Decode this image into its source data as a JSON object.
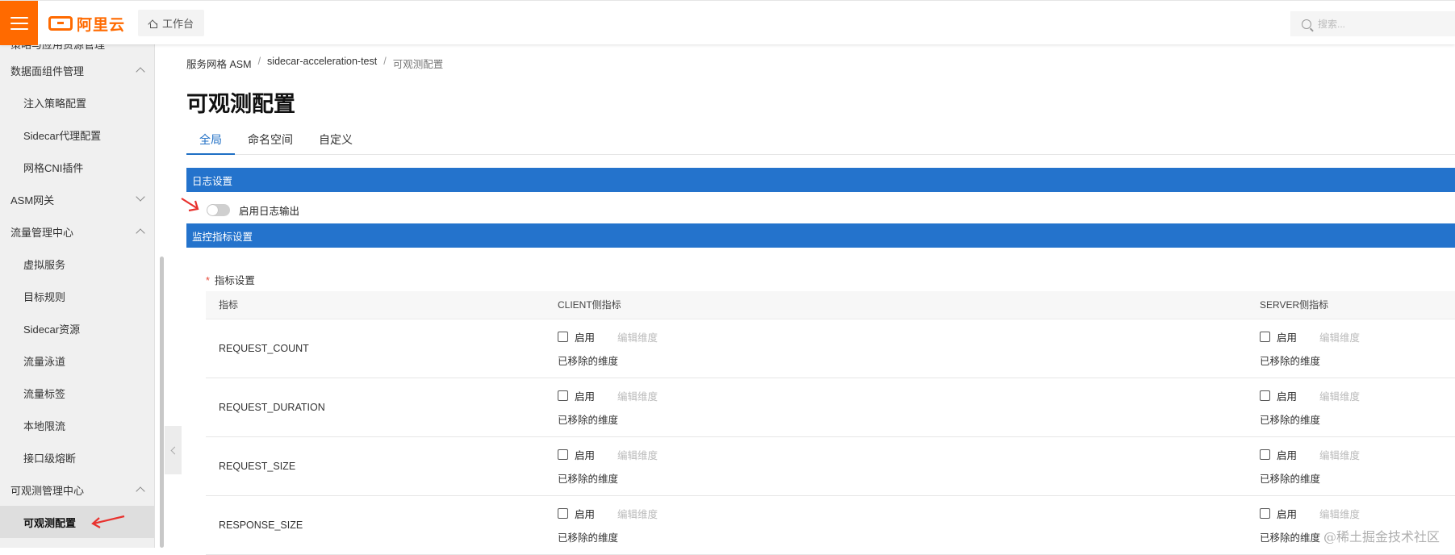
{
  "topbar": {
    "logo_text": "阿里云",
    "workbench_label": "工作台",
    "search_placeholder": "搜索..."
  },
  "sidebar": {
    "cut_item": "策略与应用资源管理",
    "groups": [
      {
        "label": "数据面组件管理",
        "expanded": true
      },
      {
        "label": "ASM网关",
        "expanded": false
      },
      {
        "label": "流量管理中心",
        "expanded": true
      },
      {
        "label": "可观测管理中心",
        "expanded": true
      }
    ],
    "items": [
      {
        "label": "注入策略配置"
      },
      {
        "label": "Sidecar代理配置"
      },
      {
        "label": "网格CNI插件"
      },
      {
        "label": "虚拟服务"
      },
      {
        "label": "目标规则"
      },
      {
        "label": "Sidecar资源"
      },
      {
        "label": "流量泳道"
      },
      {
        "label": "流量标签"
      },
      {
        "label": "本地限流"
      },
      {
        "label": "接口级熔断"
      },
      {
        "label": "可观测配置",
        "active": true
      }
    ]
  },
  "breadcrumb": [
    "服务网格 ASM",
    "sidecar-acceleration-test",
    "可观测配置"
  ],
  "page_title": "可观测配置",
  "tabs": [
    {
      "label": "全局",
      "active": true
    },
    {
      "label": "命名空间"
    },
    {
      "label": "自定义"
    }
  ],
  "log_section": {
    "title": "日志设置",
    "toggle_label": "启用日志输出",
    "toggle_on": false
  },
  "monitor_section": {
    "title": "监控指标设置",
    "metric_setting_label": "指标设置",
    "columns": [
      "指标",
      "CLIENT侧指标",
      "SERVER侧指标"
    ],
    "enable_label": "启用",
    "edit_dim_label": "编辑维度",
    "removed_dim_label": "已移除的维度",
    "rows": [
      {
        "metric": "REQUEST_COUNT"
      },
      {
        "metric": "REQUEST_DURATION"
      },
      {
        "metric": "REQUEST_SIZE"
      },
      {
        "metric": "RESPONSE_SIZE"
      }
    ]
  },
  "watermark": "@稀土掘金技术社区",
  "colors": {
    "brand": "#ff6a00",
    "section_bar": "#2473cc",
    "tab_active": "#1f6fc5",
    "annotation_arrow": "#e8332f"
  }
}
